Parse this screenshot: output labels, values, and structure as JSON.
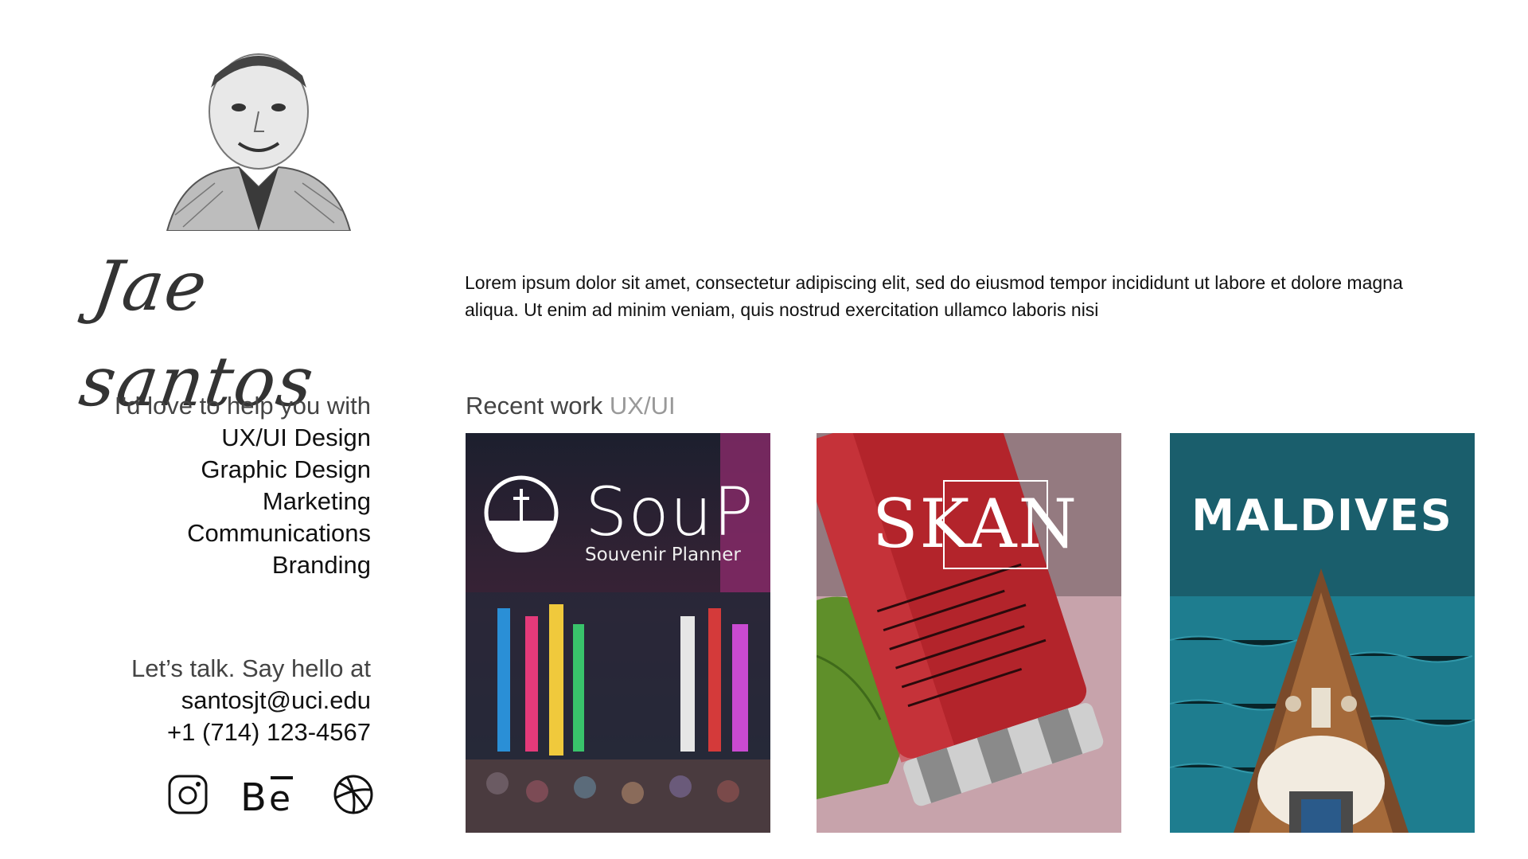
{
  "profile": {
    "signature": "Jae santos",
    "bio": "Lorem ipsum dolor sit amet, consectetur adipiscing elit, sed do eiusmod tempor incididunt ut labore et dolore magna aliqua. Ut enim ad minim veniam, quis nostrud exercitation ullamco laboris nisi"
  },
  "services": {
    "intro": "I’d love to help you with",
    "items": [
      "UX/UI Design",
      "Graphic Design",
      "Marketing",
      "Communications",
      "Branding"
    ]
  },
  "contact": {
    "intro": "Let’s talk. Say hello at",
    "email": "santosjt@uci.edu",
    "phone": "+1 (714) 123-4567"
  },
  "social": {
    "icons": [
      "instagram-icon",
      "behance-icon",
      "dribbble-icon"
    ]
  },
  "recent_work": {
    "label": "Recent work",
    "accent": "UX/UI",
    "projects": [
      {
        "title": "SouP",
        "subtitle": "Souvenir Planner"
      },
      {
        "title": "SKAN"
      },
      {
        "title": "MALDIVES"
      }
    ]
  },
  "colors": {
    "text": "#111111",
    "muted": "#444444",
    "accent_gray": "#999999",
    "skan_red": "#b3242b",
    "maldives_teal": "#1e6b78"
  }
}
